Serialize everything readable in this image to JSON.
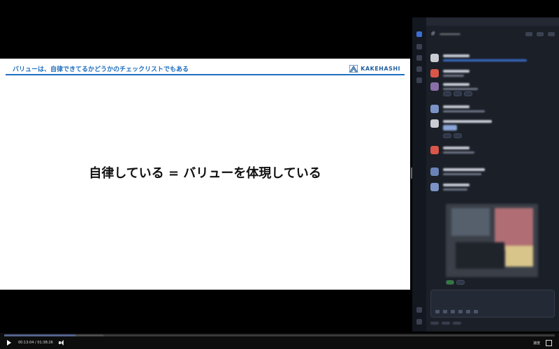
{
  "slide": {
    "title": "バリューは、自律できてるかどうかのチェックリストでもある",
    "brand": "KAKEHASHI",
    "main_text": "自律している = バリューを体現している",
    "accent_color": "#1f6fbf"
  },
  "player": {
    "current_time": "00:13:04",
    "separator": " / ",
    "duration": "01:38:26",
    "speed_label": "速度",
    "progress": 0.13,
    "accent_color": "#4d6fd8"
  }
}
